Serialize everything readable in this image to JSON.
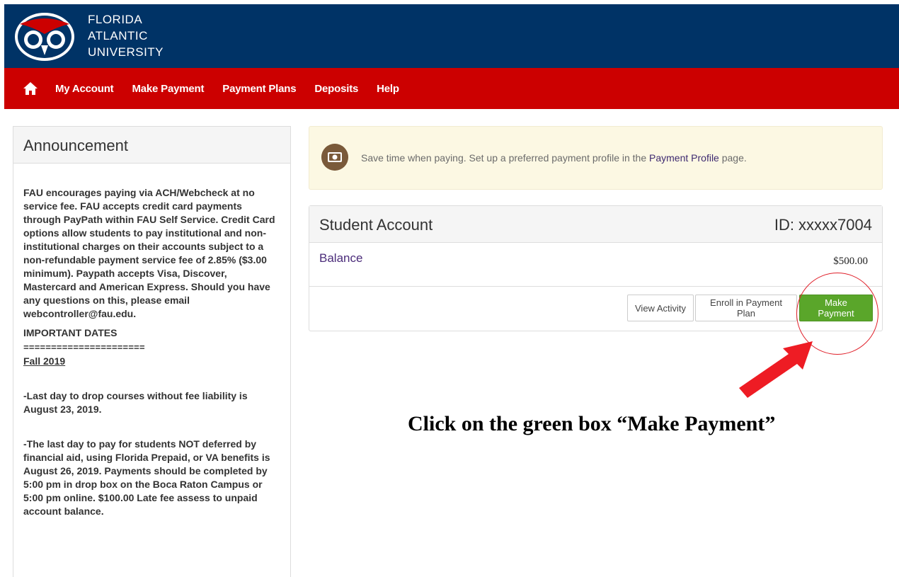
{
  "header": {
    "university_line1": "FLORIDA",
    "university_line2": "ATLANTIC",
    "university_line3": "UNIVERSITY",
    "colors": {
      "navy": "#003366",
      "red": "#cc0000"
    }
  },
  "nav": {
    "items": [
      "My Account",
      "Make Payment",
      "Payment Plans",
      "Deposits",
      "Help"
    ]
  },
  "announcement": {
    "title": "Announcement",
    "intro": "FAU encourages paying via ACH/Webcheck at no service fee. FAU accepts credit card payments through PayPath within FAU Self Service. Credit Card options allow students to pay institutional and non-institutional charges on their accounts subject to a non-refundable payment service fee of 2.85% ($3.00 minimum). Paypath accepts Visa, Discover, Mastercard and American Express. Should you have any questions on this, please email webcontroller@fau.edu.",
    "dates_heading": "IMPORTANT DATES",
    "separator": "======================",
    "term": "Fall 2019",
    "item1": "-Last day to drop courses without fee liability is August 23, 2019.",
    "item2": "-The last day to pay for students NOT deferred by financial aid, using Florida Prepaid, or VA benefits is August 26, 2019. Payments should be completed by 5:00 pm in drop box on the Boca Raton Campus or 5:00 pm online. $100.00 Late fee assess to unpaid account balance."
  },
  "alert": {
    "text_before": "Save time when paying. Set up a preferred payment profile in the ",
    "link": "Payment Profile",
    "text_after": " page."
  },
  "account": {
    "title": "Student Account",
    "id": "ID: xxxxx7004",
    "balance_label": "Balance",
    "balance_value": "$500.00",
    "buttons": {
      "view_activity": "View Activity",
      "enroll": "Enroll in Payment Plan",
      "make_payment": "Make Payment"
    },
    "colors": {
      "pay_button": "#5aa62a"
    }
  },
  "annotation": {
    "instruction": "Click on the green box “Make Payment”",
    "color": "#e0202a"
  }
}
